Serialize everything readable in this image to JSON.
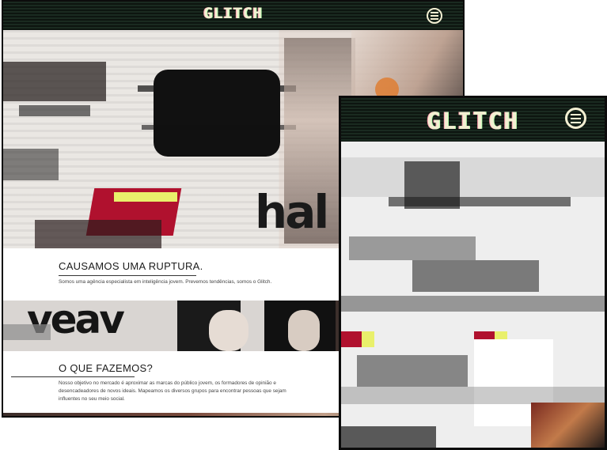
{
  "desktop": {
    "logo": "GLITCH",
    "sections": {
      "rupture_title": "CAUSAMOS UMA RUPTURA.",
      "rupture_text": "Somos uma agência especialista em inteligência jovem. Prevemos tendências, somos o Glitch.",
      "what_title": "O QUE FAZEMOS?",
      "what_text": "Nosso objetivo no mercado é aproximar as marcas do público jovem, os formadores de opinião e desencadeadores de novos ideais. Mapeamos os diversos grupos para encontrar pessoas que sejam influentes no seu meio social."
    },
    "hero_word": "hal",
    "hero2_word": "veav",
    "menu_icon": "hamburger-circle-icon"
  },
  "mobile": {
    "logo": "GLITCH",
    "menu_icon": "hamburger-circle-icon"
  },
  "colors": {
    "topbar": "#13201a",
    "logo": "#f3efd2",
    "accent_red": "#b0112e",
    "accent_yellow": "#e9f06b"
  }
}
